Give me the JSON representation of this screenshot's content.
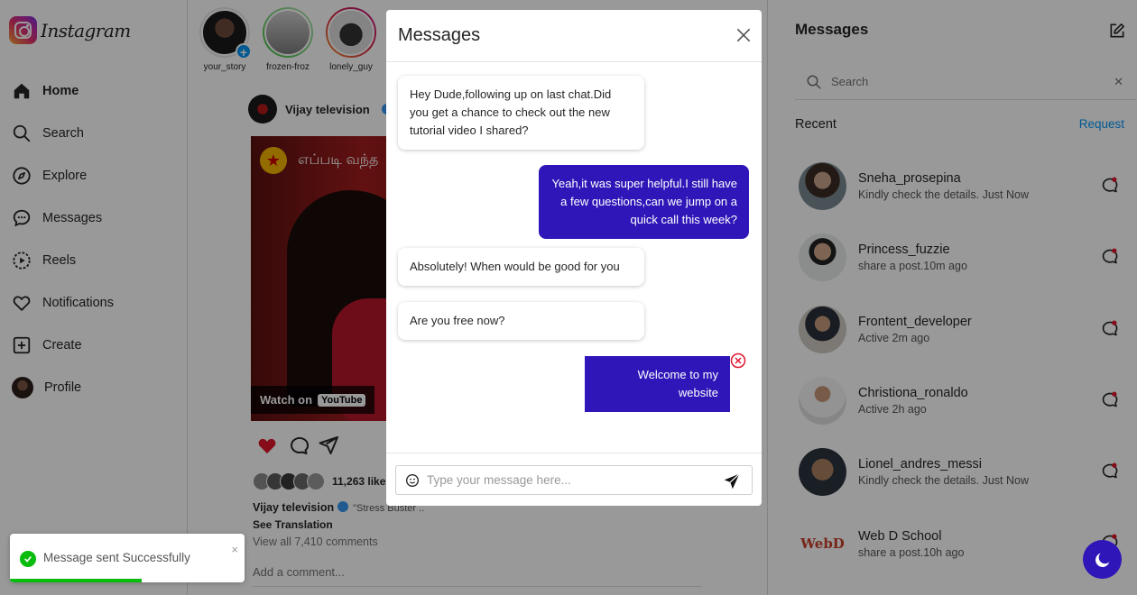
{
  "brand": {
    "name": "Instagram"
  },
  "sidebar": {
    "items": [
      {
        "label": "Home",
        "icon": "home-icon",
        "active": true
      },
      {
        "label": "Search",
        "icon": "search-icon"
      },
      {
        "label": "Explore",
        "icon": "compass-icon"
      },
      {
        "label": "Messages",
        "icon": "message-icon"
      },
      {
        "label": "Reels",
        "icon": "reels-icon"
      },
      {
        "label": "Notifications",
        "icon": "heart-icon"
      },
      {
        "label": "Create",
        "icon": "plus-square-icon"
      },
      {
        "label": "Profile",
        "icon": "avatar"
      }
    ]
  },
  "stories": [
    {
      "name": "your_story"
    },
    {
      "name": "frozen-froz"
    },
    {
      "name": "lonely_guy"
    }
  ],
  "post": {
    "user": "Vijay television",
    "video_title": "எப்படி வந்த",
    "watch_on": "Watch on",
    "youtube": "YouTube",
    "likes": "11,263 like",
    "caption_user": "Vijay television",
    "caption_text": "\"Stress Buster ..",
    "see_translation": "See Translation",
    "view_all": "View all 7,410 comments",
    "add_comment": "Add a comment..."
  },
  "modal": {
    "title": "Messages",
    "messages": [
      {
        "dir": "in",
        "text": "Hey Dude,following up on last chat.Did you get a chance to check out the new tutorial video I shared?"
      },
      {
        "dir": "out",
        "text": "Yeah,it was super helpful.I still have a few questions,can we jump on a quick call this week?"
      },
      {
        "dir": "in",
        "text": "Absolutely! When would be good for you"
      },
      {
        "dir": "in",
        "text": "Are you free now?"
      },
      {
        "dir": "out",
        "text": "Welcome to my website",
        "failed": true
      }
    ],
    "composer_placeholder": "Type your message here..."
  },
  "rpanel": {
    "title": "Messages",
    "search_placeholder": "Search",
    "recent_label": "Recent",
    "request_label": "Request",
    "conversations": [
      {
        "name": "Sneha_prosepina",
        "msg": "Kindly check the details. Just Now"
      },
      {
        "name": "Princess_fuzzie",
        "msg": "share a post.10m ago"
      },
      {
        "name": "Frontent_developer",
        "msg": "Active 2m ago"
      },
      {
        "name": "Christiona_ronaldo",
        "msg": "Active 2h ago"
      },
      {
        "name": "Lionel_andres_messi",
        "msg": "Kindly check the details. Just Now"
      },
      {
        "name": "Web D School",
        "msg": "share a post.10h ago"
      }
    ]
  },
  "toast": {
    "text": "Message sent Successfully",
    "close": "×",
    "progress": 0.56
  },
  "colors": {
    "accent": "#2f16b8",
    "link": "#0095f6",
    "success": "#07bc0c",
    "like": "#e0142b"
  }
}
